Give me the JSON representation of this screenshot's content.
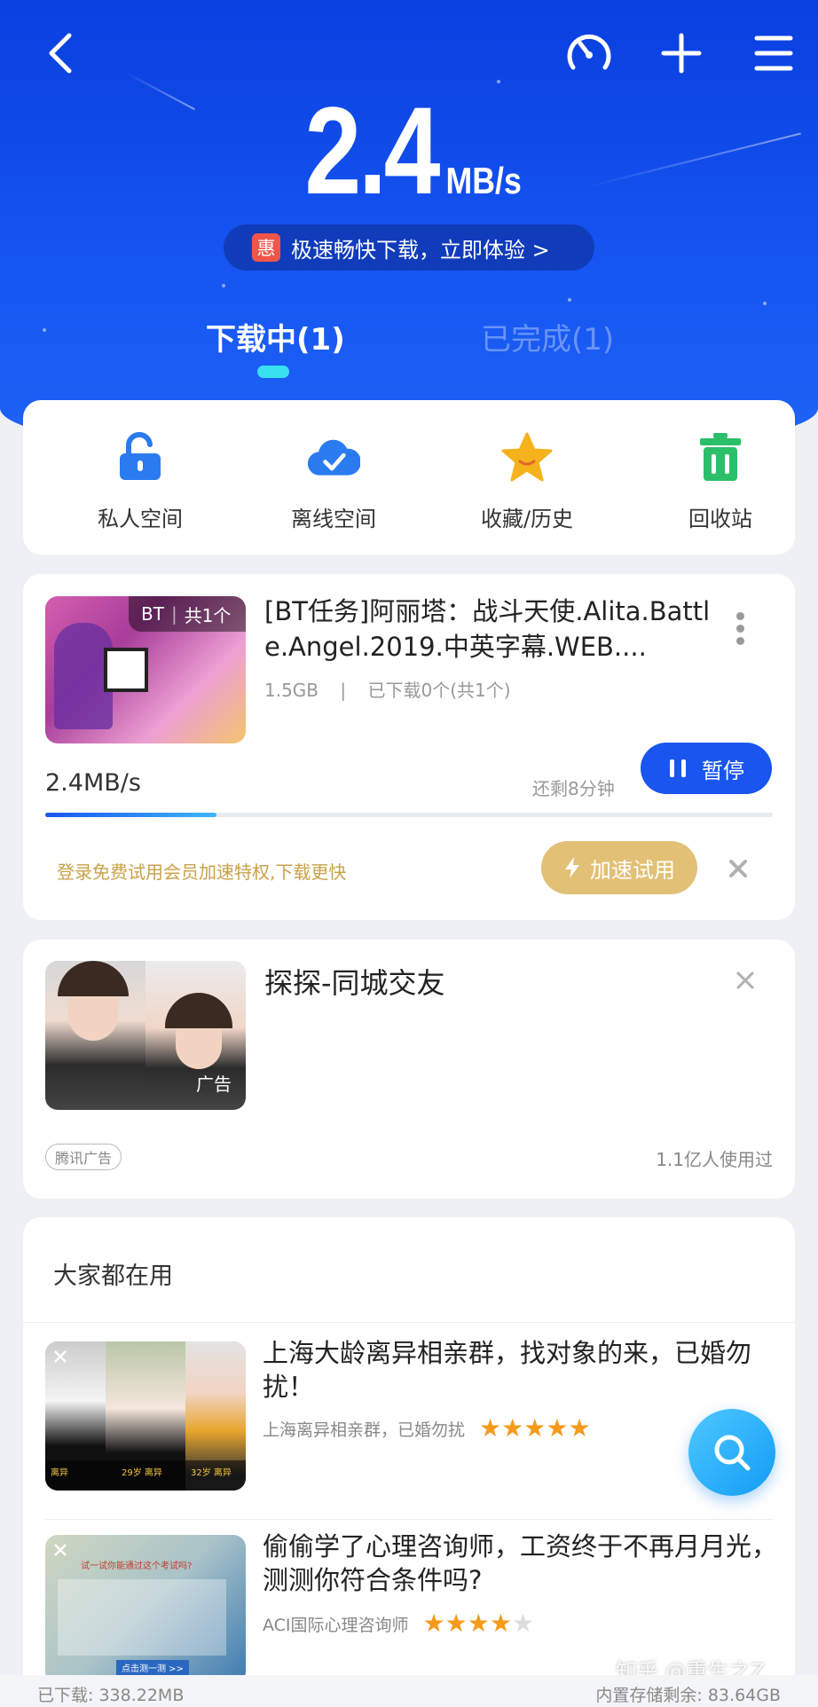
{
  "header": {
    "speed_value": "2.4",
    "speed_unit": "MB/s",
    "promo_badge": "惠",
    "promo_text": "极速畅快下载，立即体验 >",
    "tabs": [
      {
        "label": "下载中(1)",
        "active": true
      },
      {
        "label": "已完成(1)",
        "active": false
      }
    ],
    "icons": [
      "back-icon",
      "speedometer-icon",
      "plus-icon",
      "menu-icon"
    ]
  },
  "quick_access": [
    {
      "label": "私人空间",
      "icon": "lock-icon",
      "color": "#2a7bf0"
    },
    {
      "label": "离线空间",
      "icon": "cloud-check-icon",
      "color": "#2a7bf0"
    },
    {
      "label": "收藏/历史",
      "icon": "star-icon",
      "color": "#f5b21b"
    },
    {
      "label": "回收站",
      "icon": "trash-icon",
      "color": "#2bbf6a"
    }
  ],
  "download_task": {
    "badge_bt": "BT",
    "badge_count": "共1个",
    "title": "[BT任务]阿丽塔：战斗天使.Alita.Battle.Angel.2019.中英字幕.WEB....",
    "size": "1.5GB",
    "progress_text": "已下载0个(共1个)",
    "speed": "2.4MB/s",
    "remaining": "还剩8分钟",
    "pause_label": "暂停",
    "progress_fraction": 0.235,
    "vip_tip": "登录免费试用会员加速特权,下载更快",
    "accel_label": "加速试用"
  },
  "ad_card": {
    "title": "探探-同城交友",
    "ad_tag": "广告",
    "source": "腾讯广告",
    "users": "1.1亿人使用过"
  },
  "popular": {
    "heading": "大家都在用",
    "items": [
      {
        "title": "上海大龄离异相亲群，找对象的来，已婚勿扰！",
        "subtitle": "上海离异相亲群，已婚勿扰",
        "rating": 5,
        "thumb_captions": [
          "离异",
          "29岁 离异",
          "32岁 离异"
        ]
      },
      {
        "title": "偷偷学了心理咨询师，工资终于不再月月光，测测你符合条件吗?",
        "subtitle": "ACI国际心理咨询师",
        "rating": 4,
        "thumb_captions": [
          "试一试你能通过这个考试吗?",
          "点击测一测 >>"
        ]
      }
    ]
  },
  "footer": {
    "downloaded": "已下载: 338.22MB",
    "storage": "内置存储剩余: 83.64GB",
    "watermark": "知乎 @重生之Z"
  },
  "colors": {
    "brand_blue": "#1a55f0",
    "accent_gold": "#e2c076",
    "star": "#f59a1b"
  }
}
